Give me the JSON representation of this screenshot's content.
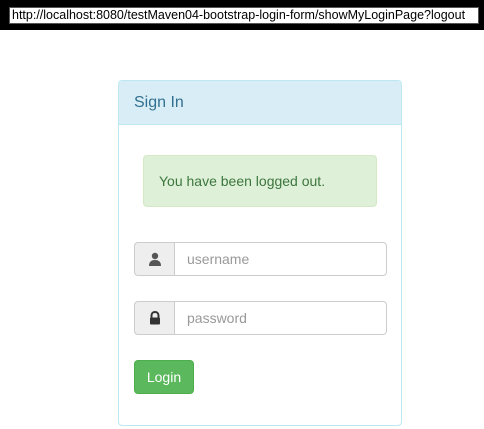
{
  "browser": {
    "url": "http://localhost:8080/testMaven04-bootstrap-login-form/showMyLoginPage?logout"
  },
  "panel": {
    "title": "Sign In"
  },
  "alert": {
    "message": "You have been logged out."
  },
  "form": {
    "username": {
      "value": "",
      "placeholder": "username",
      "icon": "user-icon"
    },
    "password": {
      "value": "",
      "placeholder": "password",
      "icon": "lock-icon"
    },
    "login_label": "Login"
  },
  "colors": {
    "panel_heading_bg": "#d9edf7",
    "panel_heading_text": "#31708f",
    "alert_bg": "#dff0d8",
    "alert_text": "#3c763d",
    "button_bg": "#5cb85c"
  }
}
